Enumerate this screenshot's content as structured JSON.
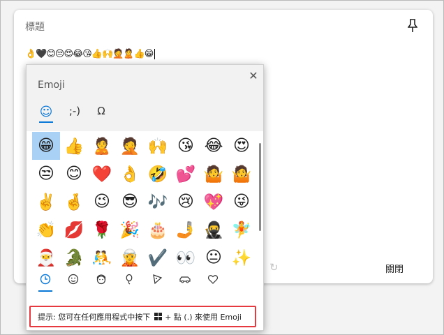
{
  "note": {
    "title": "標題",
    "body_text": "👌🖤😊😒😍😂😘👍🙌🤦🙎👍😁",
    "close_label": "關閉"
  },
  "emoji_panel": {
    "title": "Emoji",
    "category_tabs": [
      {
        "label": "☺",
        "name": "emoji"
      },
      {
        "label": ";-)",
        "name": "kaomoji"
      },
      {
        "label": "Ω",
        "name": "symbols"
      }
    ],
    "emoji_rows": [
      [
        "😁",
        "👍",
        "🙎",
        "🤦",
        "🙌",
        "😘",
        "😂",
        "😍"
      ],
      [
        "😒",
        "😊",
        "❤️",
        "👌",
        "🤣",
        "💕",
        "🤷",
        "🤷"
      ],
      [
        "✌️",
        "🤞",
        "😉",
        "😎",
        "🎶",
        "😢",
        "💖",
        "😜"
      ],
      [
        "👏",
        "💋",
        "🌹",
        "🎉",
        "🎂",
        "🤳",
        "🥷",
        "🧚"
      ],
      [
        "🎅",
        "🐊",
        "🤼",
        "🧝",
        "✔️",
        "👀",
        "😐",
        "✨"
      ]
    ],
    "bottom_tabs": [
      "clock-icon",
      "smiley-icon",
      "face-with-headphones-icon",
      "balloon-icon",
      "pizza-icon",
      "car-icon",
      "heart-icon"
    ],
    "tip": {
      "prefix": "提示: 您可在任何應用程式中按下",
      "suffix": "+ 點 (.) 來使用 Emoji"
    }
  },
  "colors": {
    "accent": "#0a78d7",
    "selected_cell": "#a9d1f5",
    "tip_border": "#e5393f"
  }
}
